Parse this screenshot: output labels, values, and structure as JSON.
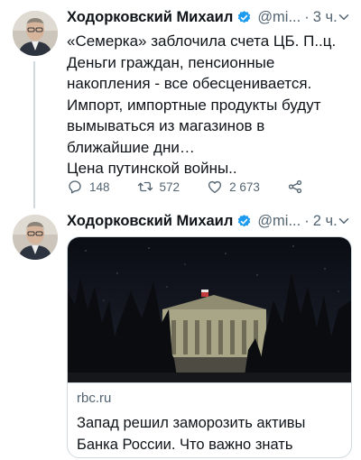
{
  "tweets": [
    {
      "author_name": "Ходорковский Михаил",
      "handle": "@mi...",
      "time": "3 ч.",
      "text_lines": [
        "«Семерка» заблочила счета ЦБ. П..ц.",
        "Деньги граждан, пенсионные",
        "накопления - все обесценивается.",
        "Импорт, импортные продукты будут",
        "вымываться из магазинов в",
        "ближайшие дни…",
        "Цена путинской войны.."
      ],
      "replies": "148",
      "retweets": "572",
      "likes": "2 673"
    },
    {
      "author_name": "Ходорковский Михаил",
      "handle": "@mi...",
      "time": "2 ч.",
      "card": {
        "domain": "rbc.ru",
        "title": "Запад решил заморозить активы Банка России. Что важно знать"
      }
    }
  ],
  "colors": {
    "text": "#0f1419",
    "secondary": "#536471",
    "verified": "#1d9bf0",
    "border": "#cfd9de"
  },
  "icons": [
    "verified-badge-icon",
    "more-icon",
    "reply-icon",
    "retweet-icon",
    "like-icon",
    "share-icon"
  ]
}
